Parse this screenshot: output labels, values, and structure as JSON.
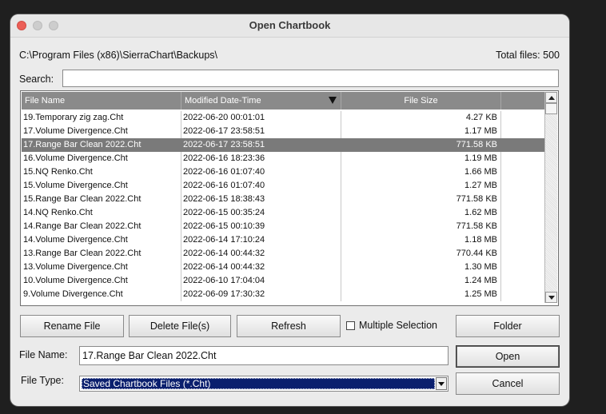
{
  "window": {
    "title": "Open Chartbook"
  },
  "path": "C:\\Program Files (x86)\\SierraChart\\Backups\\",
  "total_files": "Total files: 500",
  "search": {
    "label": "Search:",
    "value": ""
  },
  "table": {
    "columns": [
      "File Name",
      "Modified Date-Time",
      "File Size",
      ""
    ],
    "rows": [
      {
        "name": "19.Temporary zig zag.Cht",
        "date": "2022-06-20  00:01:01",
        "size": "4.27 KB"
      },
      {
        "name": "17.Volume Divergence.Cht",
        "date": "2022-06-17  23:58:51",
        "size": "1.17 MB"
      },
      {
        "name": "17.Range Bar Clean 2022.Cht",
        "date": "2022-06-17  23:58:51",
        "size": "771.58 KB",
        "selected": true
      },
      {
        "name": "16.Volume Divergence.Cht",
        "date": "2022-06-16  18:23:36",
        "size": "1.19 MB"
      },
      {
        "name": "15.NQ Renko.Cht",
        "date": "2022-06-16  01:07:40",
        "size": "1.66 MB"
      },
      {
        "name": "15.Volume Divergence.Cht",
        "date": "2022-06-16  01:07:40",
        "size": "1.27 MB"
      },
      {
        "name": "15.Range Bar Clean 2022.Cht",
        "date": "2022-06-15  18:38:43",
        "size": "771.58 KB"
      },
      {
        "name": "14.NQ Renko.Cht",
        "date": "2022-06-15  00:35:24",
        "size": "1.62 MB"
      },
      {
        "name": "14.Range Bar Clean 2022.Cht",
        "date": "2022-06-15  00:10:39",
        "size": "771.58 KB"
      },
      {
        "name": "14.Volume Divergence.Cht",
        "date": "2022-06-14  17:10:24",
        "size": "1.18 MB"
      },
      {
        "name": "13.Range Bar Clean 2022.Cht",
        "date": "2022-06-14  00:44:32",
        "size": "770.44 KB"
      },
      {
        "name": "13.Volume Divergence.Cht",
        "date": "2022-06-14  00:44:32",
        "size": "1.30 MB"
      },
      {
        "name": "10.Volume Divergence.Cht",
        "date": "2022-06-10  17:04:04",
        "size": "1.24 MB"
      },
      {
        "name": "9.Volume Divergence.Cht",
        "date": "2022-06-09  17:30:32",
        "size": "1.25 MB"
      }
    ]
  },
  "buttons": {
    "rename": "Rename File",
    "delete": "Delete File(s)",
    "refresh": "Refresh",
    "multiple": "Multiple Selection",
    "folder": "Folder",
    "open": "Open",
    "cancel": "Cancel"
  },
  "file_name": {
    "label": "File Name:",
    "value": "17.Range Bar Clean 2022.Cht"
  },
  "file_type": {
    "label": "File Type:",
    "value": "Saved Chartbook Files (*.Cht)"
  }
}
